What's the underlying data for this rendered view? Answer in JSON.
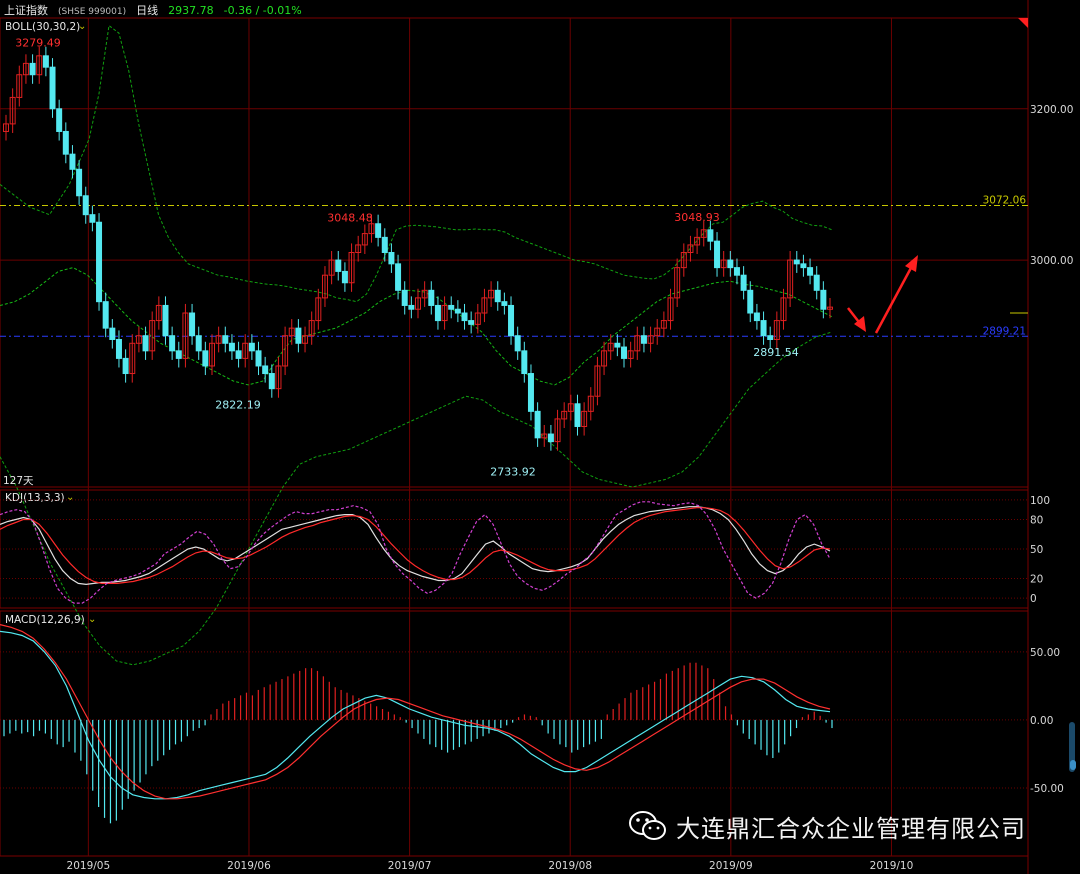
{
  "header": {
    "name": "上证指数",
    "code": "(SHSE 999001)",
    "period": "日线",
    "price": "2937.78",
    "change": "-0.36 / -0.01%"
  },
  "watermark": "大连鼎汇合众企业管理有限公司",
  "colors": {
    "up": "#e02020",
    "down": "#54e8f0",
    "grid": "#6a0000",
    "mid_band": "#15b815",
    "outer_band": "#10a010",
    "k_line": "#e0e0e0",
    "d_line": "#ff2a2a",
    "j_line": "#d040d0",
    "dif_line": "#54e8f0",
    "dea_line": "#ff3030",
    "ref_yellow": "#c8c800",
    "ref_blue": "#2a3cff",
    "arrow": "#ff2020",
    "axis_text": "#d8d8d8"
  },
  "chart_data": [
    {
      "type": "candlestick",
      "indicator": "BOLL(30,30,2)",
      "period_label": "127天",
      "x_ticks": [
        "2019/05",
        "2019/06",
        "2019/07",
        "2019/08",
        "2019/09",
        "2019/10"
      ],
      "y_ticks": [
        "3200.00",
        "3000.00"
      ],
      "ylim": [
        2700,
        3320
      ],
      "ref_lines": [
        {
          "value": 3072.06,
          "label": "3072.06",
          "color": "yellow"
        },
        {
          "value": 2899.21,
          "label": "2899.21",
          "color": "blue"
        }
      ],
      "annotations": [
        {
          "label": "3279.49",
          "value": 3279.49,
          "color": "red"
        },
        {
          "label": "2822.19",
          "value": 2822.19,
          "color": "cyan"
        },
        {
          "label": "3048.48",
          "value": 3048.48,
          "color": "red"
        },
        {
          "label": "2733.92",
          "value": 2733.92,
          "color": "cyan"
        },
        {
          "label": "3048.93",
          "value": 3048.93,
          "color": "red"
        },
        {
          "label": "2891.54",
          "value": 2891.54,
          "color": "cyan"
        }
      ],
      "closes": [
        3180,
        3215,
        3245,
        3260,
        3245,
        3270,
        3255,
        3200,
        3170,
        3140,
        3120,
        3085,
        3060,
        3050,
        2945,
        2910,
        2895,
        2870,
        2850,
        2890,
        2900,
        2880,
        2920,
        2940,
        2900,
        2880,
        2870,
        2930,
        2900,
        2880,
        2860,
        2890,
        2900,
        2890,
        2880,
        2870,
        2890,
        2880,
        2860,
        2850,
        2830,
        2860,
        2900,
        2910,
        2890,
        2900,
        2920,
        2950,
        2980,
        3000,
        2985,
        2970,
        3010,
        3020,
        3035,
        3048,
        3030,
        3010,
        2995,
        2960,
        2940,
        2935,
        2950,
        2960,
        2940,
        2920,
        2940,
        2935,
        2930,
        2920,
        2915,
        2930,
        2950,
        2960,
        2945,
        2940,
        2900,
        2880,
        2850,
        2800,
        2765,
        2770,
        2760,
        2790,
        2800,
        2810,
        2780,
        2800,
        2820,
        2860,
        2880,
        2890,
        2885,
        2870,
        2880,
        2900,
        2890,
        2900,
        2910,
        2920,
        2950,
        2990,
        3010,
        3020,
        3030,
        3040,
        3025,
        2990,
        3000,
        2990,
        2980,
        2960,
        2930,
        2920,
        2900,
        2895,
        2920,
        2950,
        3000,
        2995,
        2990,
        2980,
        2960,
        2935,
        2937.78
      ],
      "upper_band": [
        3100,
        3090,
        3080,
        3070,
        3065,
        3060,
        3080,
        3100,
        3130,
        3160,
        3220,
        3310,
        3300,
        3250,
        3180,
        3120,
        3060,
        3030,
        3010,
        2995,
        2990,
        2985,
        2980,
        2978,
        2975,
        2972,
        2970,
        2968,
        2967,
        2965,
        2962,
        2960,
        2958,
        2955,
        2950,
        2948,
        2945,
        2955,
        2980,
        3010,
        3040,
        3045,
        3046,
        3045,
        3044,
        3042,
        3040,
        3040,
        3041,
        3040,
        3040,
        3037,
        3030,
        3025,
        3020,
        3015,
        3010,
        3005,
        3000,
        2998,
        2995,
        2990,
        2985,
        2980,
        2978,
        2976,
        2975,
        2980,
        2990,
        3005,
        3020,
        3035,
        3048,
        3050,
        3060,
        3070,
        3075,
        3078,
        3070,
        3065,
        3055,
        3050,
        3046,
        3045,
        3040
      ],
      "mid_band": [
        2940,
        2945,
        2955,
        2970,
        2985,
        2990,
        2980,
        2960,
        2940,
        2920,
        2905,
        2890,
        2880,
        2870,
        2860,
        2850,
        2840,
        2835,
        2840,
        2870,
        2895,
        2900,
        2905,
        2910,
        2920,
        2930,
        2945,
        2955,
        2960,
        2958,
        2950,
        2935,
        2920,
        2905,
        2880,
        2860,
        2850,
        2840,
        2835,
        2845,
        2865,
        2880,
        2900,
        2915,
        2930,
        2945,
        2955,
        2960,
        2965,
        2970,
        2972,
        2968,
        2965,
        2960,
        2955,
        2945,
        2935,
        2925
      ],
      "lower_band": [
        2740,
        2700,
        2650,
        2600,
        2560,
        2520,
        2490,
        2470,
        2465,
        2470,
        2480,
        2490,
        2510,
        2540,
        2580,
        2620,
        2660,
        2700,
        2730,
        2740,
        2745,
        2750,
        2760,
        2770,
        2780,
        2790,
        2800,
        2810,
        2820,
        2815,
        2800,
        2790,
        2780,
        2760,
        2740,
        2720,
        2710,
        2705,
        2700,
        2705,
        2710,
        2720,
        2740,
        2770,
        2800,
        2830,
        2850,
        2870,
        2885,
        2898,
        2905
      ]
    },
    {
      "type": "line",
      "indicator": "KDJ(13,3,3)",
      "y_ticks": [
        "100",
        "80",
        "50",
        "20",
        "0"
      ],
      "ylim": [
        -10,
        110
      ],
      "series": [
        {
          "values": [
            75,
            78,
            80,
            82,
            80,
            70,
            55,
            40,
            28,
            20,
            15,
            14,
            15,
            16,
            16,
            17,
            18,
            20,
            22,
            25,
            30,
            35,
            40,
            45,
            50,
            52,
            50,
            45,
            40,
            38,
            40,
            45,
            50,
            55,
            60,
            65,
            70,
            72,
            74,
            76,
            78,
            80,
            82,
            84,
            85,
            85,
            82,
            75,
            62,
            50,
            40,
            33,
            28,
            25,
            22,
            20,
            18,
            18,
            20,
            25,
            35,
            45,
            55,
            58,
            52,
            45,
            40,
            35,
            30,
            28,
            27,
            28,
            30,
            32,
            35,
            40,
            50,
            60,
            68,
            75,
            80,
            84,
            86,
            88,
            89,
            90,
            91,
            92,
            93,
            93,
            92,
            90,
            86,
            80,
            70,
            58,
            45,
            35,
            28,
            25,
            28,
            35,
            45,
            52,
            55,
            52,
            48
          ]
        },
        {
          "values": [
            70,
            74,
            77,
            80,
            80,
            75,
            66,
            55,
            44,
            35,
            27,
            21,
            17,
            15,
            15,
            15,
            16,
            17,
            19,
            21,
            24,
            28,
            32,
            37,
            42,
            46,
            48,
            47,
            44,
            41,
            40,
            41,
            44,
            48,
            52,
            57,
            62,
            66,
            69,
            72,
            74,
            77,
            79,
            81,
            83,
            84,
            83,
            80,
            73,
            64,
            55,
            47,
            39,
            33,
            28,
            24,
            21,
            19,
            19,
            21,
            26,
            33,
            41,
            47,
            49,
            47,
            44,
            40,
            36,
            32,
            29,
            28,
            28,
            29,
            31,
            34,
            40,
            48,
            56,
            64,
            71,
            77,
            81,
            84,
            86,
            88,
            89,
            90,
            91,
            92,
            92,
            91,
            89,
            85,
            78,
            69,
            59,
            49,
            40,
            33,
            30,
            32,
            37,
            43,
            49,
            51,
            50
          ]
        },
        {
          "values": [
            85,
            88,
            90,
            88,
            78,
            55,
            30,
            10,
            0,
            -5,
            -5,
            0,
            8,
            15,
            18,
            20,
            22,
            25,
            30,
            35,
            45,
            50,
            55,
            62,
            68,
            65,
            55,
            40,
            30,
            32,
            42,
            55,
            65,
            72,
            78,
            84,
            88,
            86,
            86,
            88,
            90,
            90,
            92,
            94,
            92,
            88,
            75,
            50,
            35,
            25,
            18,
            10,
            5,
            8,
            15,
            25,
            45,
            62,
            78,
            85,
            75,
            55,
            35,
            22,
            15,
            10,
            8,
            12,
            18,
            25,
            30,
            38,
            45,
            58,
            72,
            85,
            90,
            95,
            98,
            98,
            96,
            95,
            94,
            96,
            97,
            94,
            85,
            70,
            50,
            35,
            20,
            5,
            0,
            5,
            15,
            35,
            60,
            80,
            85,
            75,
            55,
            40
          ]
        }
      ]
    },
    {
      "type": "bar",
      "indicator": "MACD(12,26,9)",
      "y_ticks": [
        "50.00",
        "0.00",
        "-50.00"
      ],
      "ylim": [
        -100,
        80
      ],
      "series": [
        {
          "values": [
            65,
            64,
            62,
            58,
            50,
            40,
            25,
            5,
            -15,
            -30,
            -42,
            -50,
            -55,
            -57,
            -58,
            -58,
            -57,
            -55,
            -52,
            -50,
            -48,
            -46,
            -44,
            -42,
            -40,
            -35,
            -28,
            -20,
            -12,
            -5,
            2,
            8,
            12,
            16,
            18,
            16,
            12,
            8,
            5,
            2,
            0,
            -2,
            -4,
            -5,
            -6,
            -8,
            -12,
            -18,
            -25,
            -30,
            -35,
            -38,
            -38,
            -35,
            -30,
            -25,
            -20,
            -15,
            -10,
            -5,
            0,
            5,
            10,
            15,
            20,
            25,
            30,
            32,
            31,
            28,
            22,
            15,
            10,
            8,
            7,
            6
          ]
        },
        {
          "values": [
            70,
            68,
            65,
            60,
            52,
            42,
            30,
            15,
            0,
            -15,
            -28,
            -38,
            -46,
            -52,
            -56,
            -58,
            -58,
            -57,
            -56,
            -54,
            -52,
            -50,
            -48,
            -46,
            -44,
            -40,
            -35,
            -28,
            -20,
            -12,
            -5,
            2,
            8,
            12,
            15,
            16,
            15,
            12,
            9,
            6,
            3,
            1,
            -1,
            -3,
            -5,
            -7,
            -10,
            -14,
            -19,
            -24,
            -29,
            -33,
            -36,
            -37,
            -35,
            -31,
            -26,
            -21,
            -16,
            -11,
            -6,
            -1,
            4,
            9,
            14,
            19,
            24,
            28,
            30,
            30,
            27,
            22,
            17,
            13,
            10,
            8
          ]
        },
        {
          "values": [
            -12,
            -10,
            -8,
            -10,
            -9,
            -12,
            -8,
            -10,
            -14,
            -18,
            -20,
            -16,
            -24,
            -30,
            -40,
            -52,
            -64,
            -72,
            -76,
            -74,
            -66,
            -58,
            -52,
            -46,
            -40,
            -34,
            -30,
            -26,
            -22,
            -18,
            -16,
            -12,
            -8,
            -6,
            -4,
            4,
            8,
            12,
            14,
            16,
            18,
            20,
            18,
            22,
            24,
            26,
            28,
            30,
            32,
            34,
            36,
            38,
            38,
            36,
            32,
            28,
            24,
            22,
            20,
            18,
            16,
            14,
            12,
            10,
            8,
            6,
            4,
            2,
            -2,
            -6,
            -10,
            -14,
            -18,
            -20,
            -22,
            -24,
            -22,
            -20,
            -18,
            -16,
            -14,
            -12,
            -10,
            -8,
            -6,
            -4,
            -2,
            2,
            4,
            3,
            2,
            -4,
            -10,
            -14,
            -18,
            -20,
            -24,
            -22,
            -20,
            -18,
            -16,
            -14,
            4,
            8,
            12,
            16,
            20,
            22,
            24,
            26,
            28,
            30,
            34,
            36,
            38,
            40,
            42,
            42,
            40,
            38,
            30,
            20,
            10,
            4,
            -4,
            -10,
            -14,
            -18,
            -22,
            -26,
            -28,
            -24,
            -18,
            -12,
            -6,
            2,
            4,
            6,
            3,
            -2,
            -6
          ]
        }
      ]
    }
  ]
}
